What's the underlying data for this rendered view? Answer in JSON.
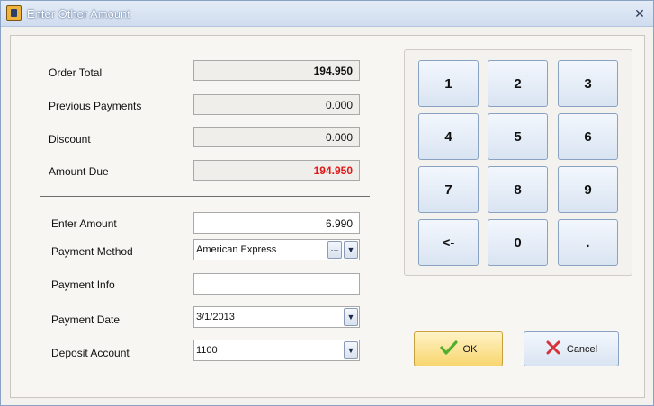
{
  "window": {
    "title": "Enter Other Amount",
    "close_glyph": "✕",
    "icon": "app-icon"
  },
  "summary": {
    "order_total_label": "Order Total",
    "order_total_value": "194.950",
    "previous_payments_label": "Previous Payments",
    "previous_payments_value": "0.000",
    "discount_label": "Discount",
    "discount_value": "0.000",
    "amount_due_label": "Amount Due",
    "amount_due_value": "194.950",
    "amount_due_color": "#e01818"
  },
  "form": {
    "enter_amount_label": "Enter Amount",
    "enter_amount_value": "6.990",
    "payment_method_label": "Payment Method",
    "payment_method_value": "American Express",
    "payment_method_ellipsis": "···",
    "payment_info_label": "Payment Info",
    "payment_info_value": "",
    "payment_date_label": "Payment Date",
    "payment_date_value": "3/1/2013",
    "deposit_account_label": "Deposit Account",
    "deposit_account_value": "1100",
    "dropdown_glyph": "▼"
  },
  "keypad": {
    "keys": [
      "1",
      "2",
      "3",
      "4",
      "5",
      "6",
      "7",
      "8",
      "9",
      "<-",
      "0",
      "."
    ]
  },
  "buttons": {
    "ok_label": "OK",
    "cancel_label": "Cancel"
  },
  "colors": {
    "ok_accent": "#f8d66e",
    "check_icon": "#4fae2c",
    "cancel_icon": "#d8333b"
  }
}
